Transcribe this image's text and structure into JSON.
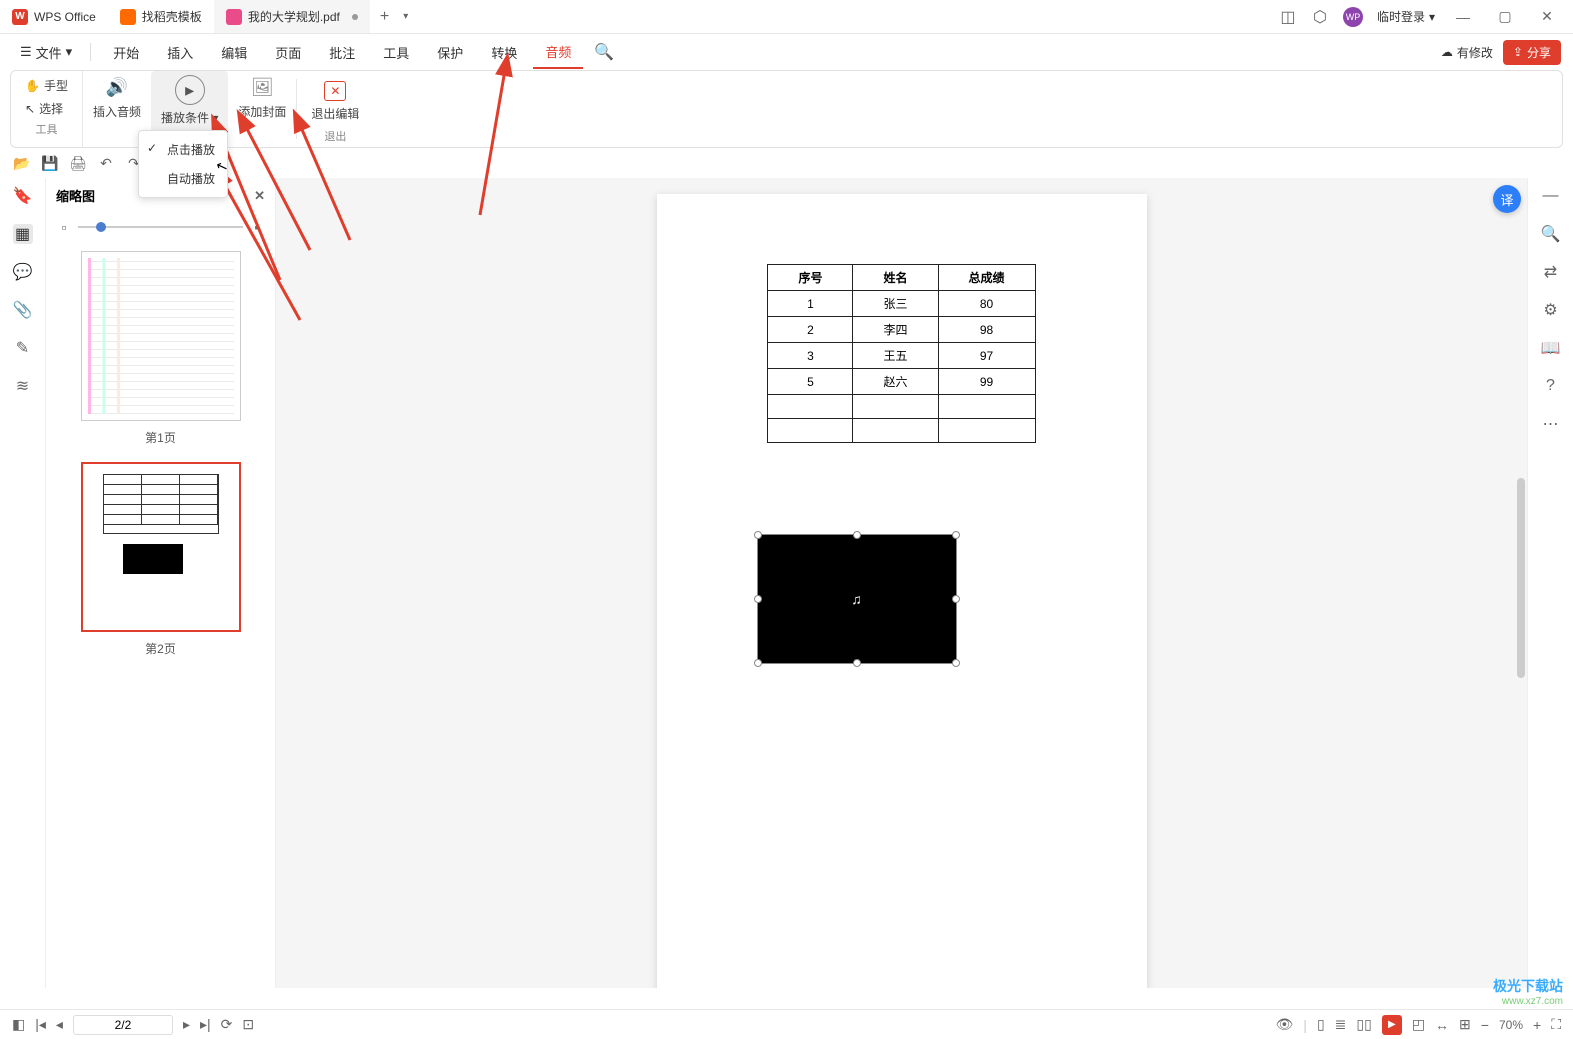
{
  "titlebar": {
    "app_name": "WPS Office",
    "tab_docer": "找稻壳模板",
    "tab_file": "我的大学规划.pdf",
    "login": "临时登录"
  },
  "menubar": {
    "file": "文件",
    "items": [
      "开始",
      "插入",
      "编辑",
      "页面",
      "批注",
      "工具",
      "保护",
      "转换",
      "音频"
    ],
    "active_index": 8,
    "modified": "有修改",
    "share": "分享"
  },
  "ribbon": {
    "hand": "手型",
    "select": "选择",
    "tools_label": "工具",
    "insert_audio": "插入音频",
    "play_cond": "播放条件",
    "add_cover": "添加封面",
    "exit_edit": "退出编辑",
    "exit_label": "退出"
  },
  "dropdown": {
    "click_play": "点击播放",
    "auto_play": "自动播放"
  },
  "thumbnail": {
    "title": "缩略图",
    "page1": "第1页",
    "page2": "第2页"
  },
  "table": {
    "headers": [
      "序号",
      "姓名",
      "总成绩"
    ],
    "rows": [
      [
        "1",
        "张三",
        "80"
      ],
      [
        "2",
        "李四",
        "98"
      ],
      [
        "3",
        "王五",
        "97"
      ],
      [
        "5",
        "赵六",
        "99"
      ],
      [
        "",
        "",
        ""
      ],
      [
        "",
        "",
        ""
      ]
    ]
  },
  "statusbar": {
    "page": "2/2",
    "zoom": "70%"
  },
  "watermark": {
    "main": "极光下载站",
    "sub": "www.xz7.com"
  }
}
